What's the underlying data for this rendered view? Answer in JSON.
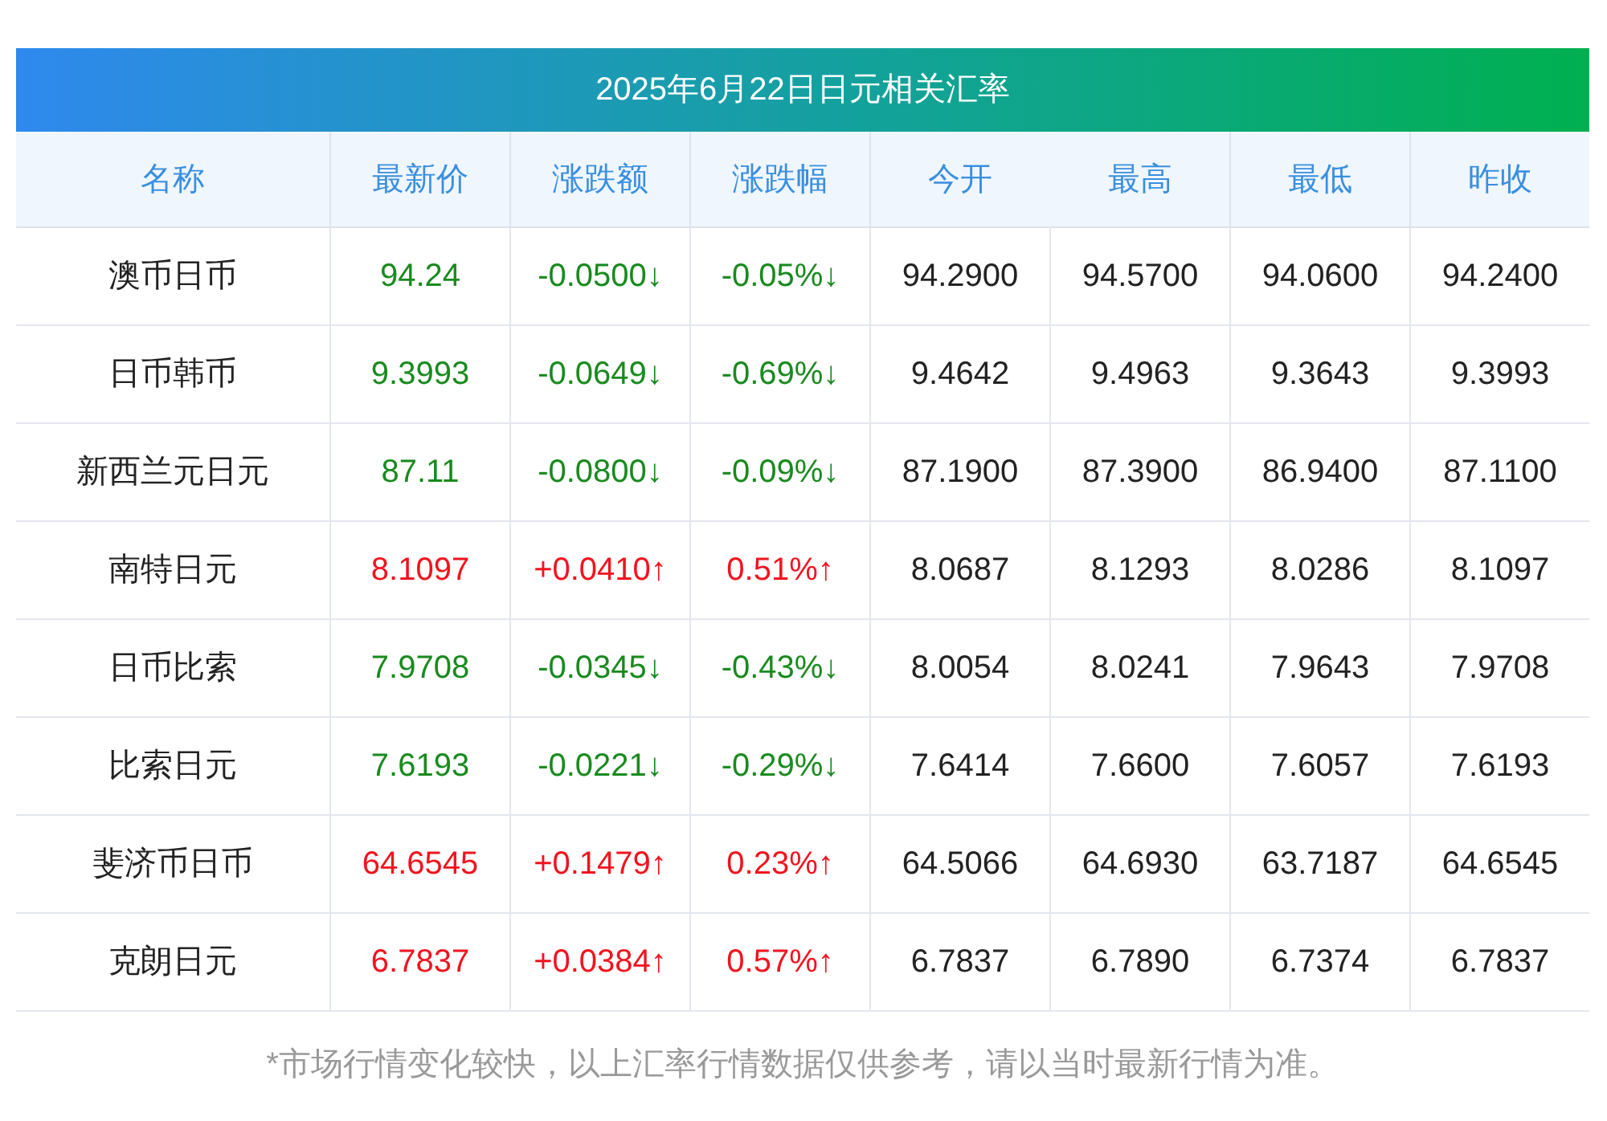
{
  "title": "2025年6月22日日元相关汇率",
  "columns": [
    "名称",
    "最新价",
    "涨跌额",
    "涨跌幅",
    "今开",
    "最高",
    "最低",
    "昨收"
  ],
  "rows": [
    {
      "rising": false,
      "cells": [
        "澳币日币",
        "94.24",
        "-0.0500↓",
        "-0.05%↓",
        "94.2900",
        "94.5700",
        "94.0600",
        "94.2400"
      ]
    },
    {
      "rising": false,
      "cells": [
        "日币韩币",
        "9.3993",
        "-0.0649↓",
        "-0.69%↓",
        "9.4642",
        "9.4963",
        "9.3643",
        "9.3993"
      ]
    },
    {
      "rising": false,
      "cells": [
        "新西兰元日元",
        "87.11",
        "-0.0800↓",
        "-0.09%↓",
        "87.1900",
        "87.3900",
        "86.9400",
        "87.1100"
      ]
    },
    {
      "rising": true,
      "cells": [
        "南特日元",
        "8.1097",
        "+0.0410↑",
        "0.51%↑",
        "8.0687",
        "8.1293",
        "8.0286",
        "8.1097"
      ]
    },
    {
      "rising": false,
      "cells": [
        "日币比索",
        "7.9708",
        "-0.0345↓",
        "-0.43%↓",
        "8.0054",
        "8.0241",
        "7.9643",
        "7.9708"
      ]
    },
    {
      "rising": false,
      "cells": [
        "比索日元",
        "7.6193",
        "-0.0221↓",
        "-0.29%↓",
        "7.6414",
        "7.6600",
        "7.6057",
        "7.6193"
      ]
    },
    {
      "rising": true,
      "cells": [
        "斐济币日币",
        "64.6545",
        "+0.1479↑",
        "0.23%↑",
        "64.5066",
        "64.6930",
        "63.7187",
        "64.6545"
      ]
    },
    {
      "rising": true,
      "cells": [
        "克朗日元",
        "6.7837",
        "+0.0384↑",
        "0.57%↑",
        "6.7837",
        "6.7890",
        "6.7374",
        "6.7837"
      ]
    }
  ],
  "footnote": "*市场行情变化较快，以上汇率行情数据仅供参考，请以当时最新行情为准。"
}
